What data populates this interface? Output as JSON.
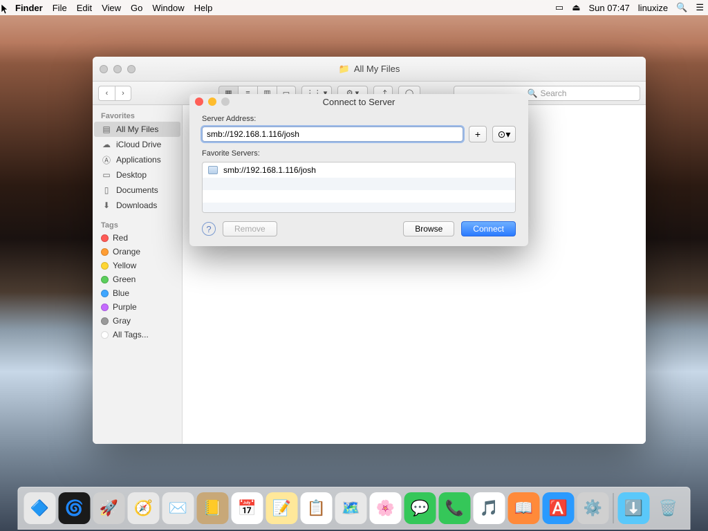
{
  "menubar": {
    "app": "Finder",
    "items": [
      "File",
      "Edit",
      "View",
      "Go",
      "Window",
      "Help"
    ],
    "clock": "Sun 07:47",
    "user": "linuxize"
  },
  "finder": {
    "title": "All My Files",
    "search_placeholder": "Search",
    "sidebar": {
      "favorites_head": "Favorites",
      "favorites": [
        "All My Files",
        "iCloud Drive",
        "Applications",
        "Desktop",
        "Documents",
        "Downloads"
      ],
      "tags_head": "Tags",
      "tags": [
        {
          "label": "Red",
          "color": "#ff5b56"
        },
        {
          "label": "Orange",
          "color": "#ff9d33"
        },
        {
          "label": "Yellow",
          "color": "#ffd633"
        },
        {
          "label": "Green",
          "color": "#5bce5b"
        },
        {
          "label": "Blue",
          "color": "#3fa6ff"
        },
        {
          "label": "Purple",
          "color": "#c56bff"
        },
        {
          "label": "Gray",
          "color": "#9a9a9a"
        }
      ],
      "all_tags": "All Tags..."
    }
  },
  "modal": {
    "title": "Connect to Server",
    "addr_label": "Server Address:",
    "addr_value": "smb://192.168.1.116/josh",
    "fav_label": "Favorite Servers:",
    "favorites": [
      "smb://192.168.1.116/josh"
    ],
    "remove": "Remove",
    "browse": "Browse",
    "connect": "Connect"
  },
  "dock": {
    "items": [
      {
        "name": "finder",
        "emoji": "🔷",
        "bg": "#e8e8e8"
      },
      {
        "name": "siri",
        "emoji": "🌀",
        "bg": "#1a1a1a"
      },
      {
        "name": "launchpad",
        "emoji": "🚀",
        "bg": "#d0d0d0"
      },
      {
        "name": "safari",
        "emoji": "🧭",
        "bg": "#e8e8e8"
      },
      {
        "name": "mail",
        "emoji": "✉️",
        "bg": "#e8e8e8"
      },
      {
        "name": "contacts",
        "emoji": "📒",
        "bg": "#c8a878"
      },
      {
        "name": "calendar",
        "emoji": "📅",
        "bg": "#fff"
      },
      {
        "name": "notes",
        "emoji": "📝",
        "bg": "#ffe89a"
      },
      {
        "name": "reminders",
        "emoji": "📋",
        "bg": "#fff"
      },
      {
        "name": "maps",
        "emoji": "🗺️",
        "bg": "#e8e8e8"
      },
      {
        "name": "photos",
        "emoji": "🌸",
        "bg": "#fff"
      },
      {
        "name": "messages",
        "emoji": "💬",
        "bg": "#35c759"
      },
      {
        "name": "facetime",
        "emoji": "📞",
        "bg": "#35c759"
      },
      {
        "name": "itunes",
        "emoji": "🎵",
        "bg": "#fff"
      },
      {
        "name": "ibooks",
        "emoji": "📖",
        "bg": "#ff8a3a"
      },
      {
        "name": "appstore",
        "emoji": "🅰️",
        "bg": "#2a9aff"
      },
      {
        "name": "settings",
        "emoji": "⚙️",
        "bg": "#d0d0d0"
      }
    ],
    "right": [
      {
        "name": "downloads",
        "emoji": "⬇️",
        "bg": "#5ac8fa"
      },
      {
        "name": "trash",
        "emoji": "🗑️",
        "bg": "transparent"
      }
    ]
  }
}
